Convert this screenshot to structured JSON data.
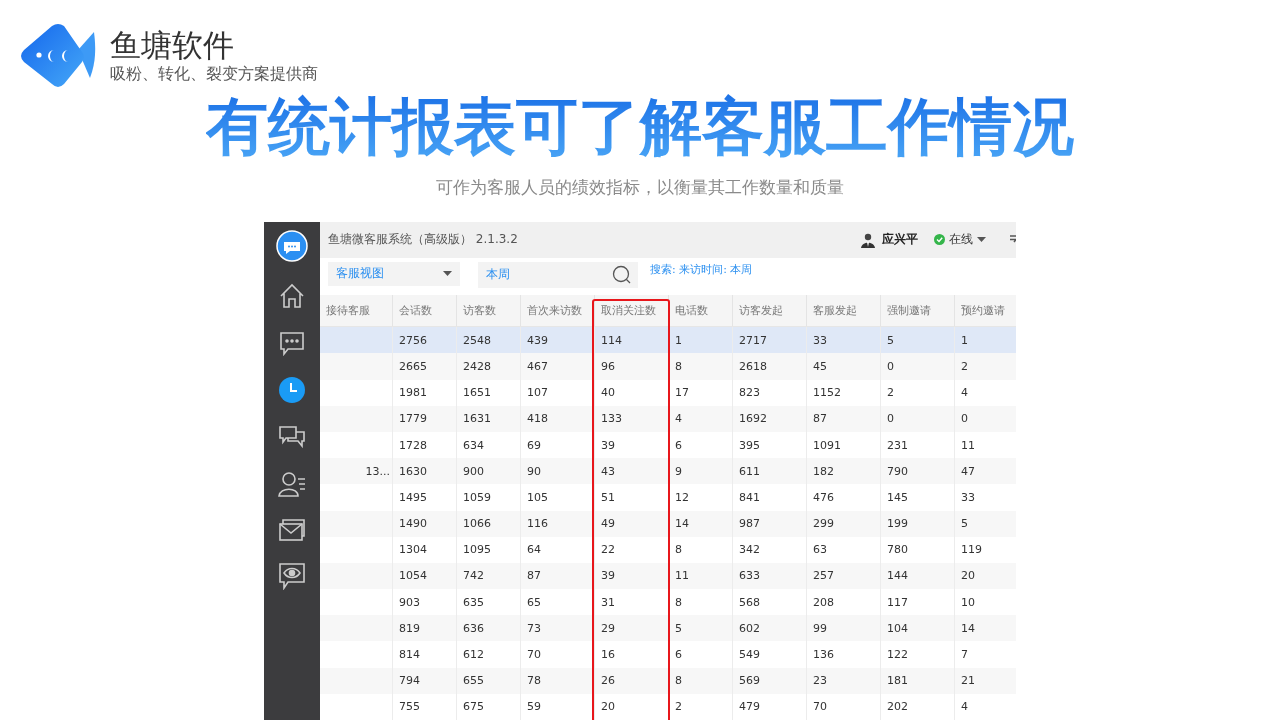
{
  "brand": {
    "name": "鱼塘软件",
    "tagline": "吸粉、转化、裂变方案提供商"
  },
  "headline": "有统计报表可了解客服工作情况",
  "subheadline": "可作为客服人员的绩效指标，以衡量其工作数量和质量",
  "app": {
    "title": "鱼塘微客服系统（高级版） 2.1.3.2",
    "user": "应兴平",
    "status": "在线",
    "sidebar": [
      {
        "kind": "home",
        "selected": false
      },
      {
        "kind": "chat",
        "selected": false
      },
      {
        "kind": "clock",
        "selected": true
      },
      {
        "kind": "chats",
        "selected": false
      },
      {
        "kind": "contacts",
        "selected": false
      },
      {
        "kind": "mail",
        "selected": false
      },
      {
        "kind": "eye",
        "selected": false
      }
    ],
    "view_select": "客服视图",
    "search": "本周",
    "filter": "搜索: 来访时间: 本周",
    "columns": [
      {
        "label": "接待客服",
        "highlighted": false
      },
      {
        "label": "会话数",
        "highlighted": false
      },
      {
        "label": "访客数",
        "highlighted": false
      },
      {
        "label": "首次来访数",
        "highlighted": false
      },
      {
        "label": "取消关注数",
        "highlighted": true
      },
      {
        "label": "电话数",
        "highlighted": false
      },
      {
        "label": "访客发起",
        "highlighted": false
      },
      {
        "label": "客服发起",
        "highlighted": false
      },
      {
        "label": "强制邀请",
        "highlighted": false
      },
      {
        "label": "预约邀请",
        "highlighted": false
      }
    ],
    "rows": [
      {
        "selected": true,
        "values": [
          "2756",
          "2548",
          "439",
          "114",
          "1",
          "2717",
          "33",
          "5",
          "1"
        ]
      },
      {
        "selected": false,
        "values": [
          "2665",
          "2428",
          "467",
          "96",
          "8",
          "2618",
          "45",
          "0",
          "2"
        ]
      },
      {
        "selected": false,
        "values": [
          "1981",
          "1651",
          "107",
          "40",
          "17",
          "823",
          "1152",
          "2",
          "4"
        ]
      },
      {
        "selected": false,
        "values": [
          "1779",
          "1631",
          "418",
          "133",
          "4",
          "1692",
          "87",
          "0",
          "0"
        ]
      },
      {
        "selected": false,
        "values": [
          "1728",
          "634",
          "69",
          "39",
          "6",
          "395",
          "1091",
          "231",
          "11"
        ]
      },
      {
        "selected": false,
        "name": "13...",
        "values": [
          "1630",
          "900",
          "90",
          "43",
          "9",
          "611",
          "182",
          "790",
          "47"
        ]
      },
      {
        "selected": false,
        "values": [
          "1495",
          "1059",
          "105",
          "51",
          "12",
          "841",
          "476",
          "145",
          "33"
        ]
      },
      {
        "selected": false,
        "values": [
          "1490",
          "1066",
          "116",
          "49",
          "14",
          "987",
          "299",
          "199",
          "5"
        ]
      },
      {
        "selected": false,
        "values": [
          "1304",
          "1095",
          "64",
          "22",
          "8",
          "342",
          "63",
          "780",
          "119"
        ]
      },
      {
        "selected": false,
        "values": [
          "1054",
          "742",
          "87",
          "39",
          "11",
          "633",
          "257",
          "144",
          "20"
        ]
      },
      {
        "selected": false,
        "values": [
          "903",
          "635",
          "65",
          "31",
          "8",
          "568",
          "208",
          "117",
          "10"
        ]
      },
      {
        "selected": false,
        "values": [
          "819",
          "636",
          "73",
          "29",
          "5",
          "602",
          "99",
          "104",
          "14"
        ]
      },
      {
        "selected": false,
        "values": [
          "814",
          "612",
          "70",
          "16",
          "6",
          "549",
          "136",
          "122",
          "7"
        ]
      },
      {
        "selected": false,
        "values": [
          "794",
          "655",
          "78",
          "26",
          "8",
          "569",
          "23",
          "181",
          "21"
        ]
      },
      {
        "selected": false,
        "values": [
          "755",
          "675",
          "59",
          "20",
          "2",
          "479",
          "70",
          "202",
          "4"
        ]
      }
    ]
  }
}
